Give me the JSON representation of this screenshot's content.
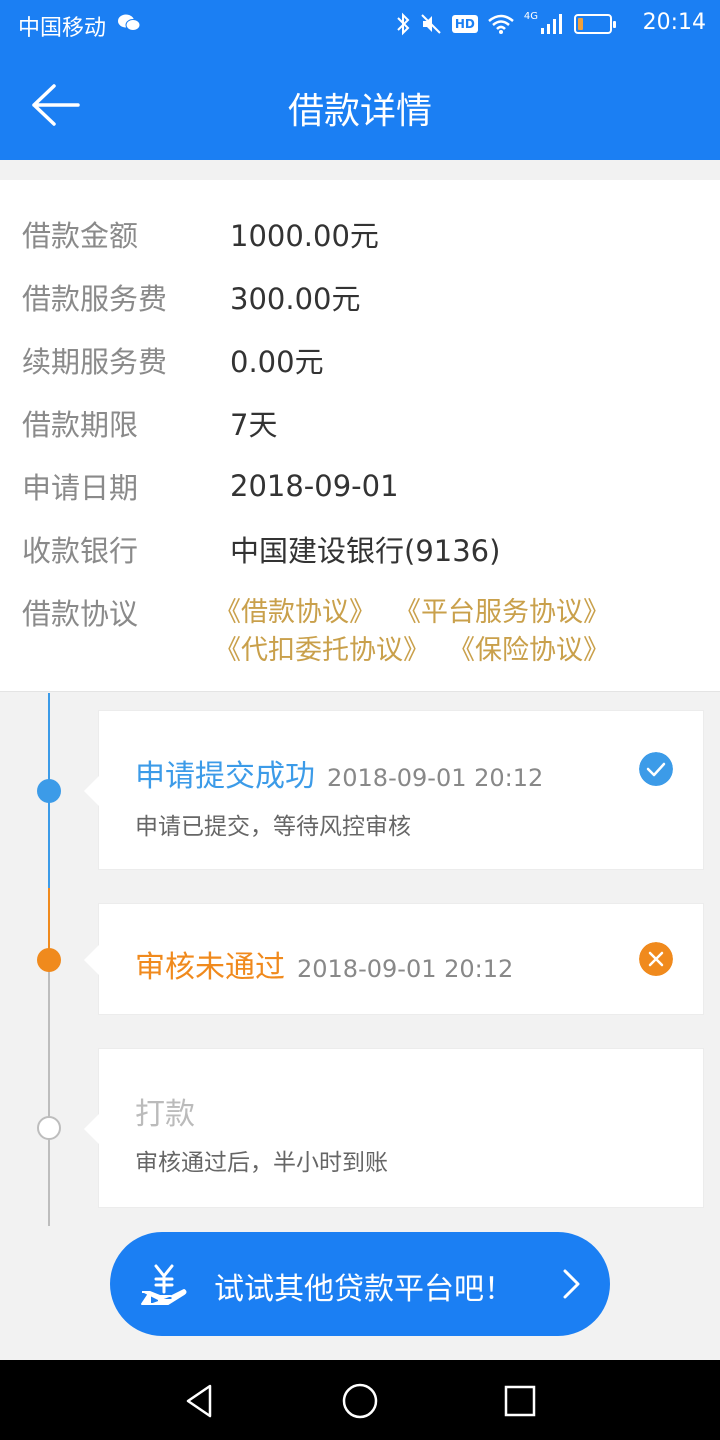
{
  "status_bar": {
    "carrier": "中国移动",
    "hd": "HD",
    "network": "4G",
    "battery_level": 0.15,
    "time": "20:14"
  },
  "nav": {
    "title": "借款详情",
    "back_icon": "back-arrow-icon"
  },
  "details": [
    {
      "label": "借款金额",
      "value": "1000.00元"
    },
    {
      "label": "借款服务费",
      "value": "300.00元"
    },
    {
      "label": "续期服务费",
      "value": "0.00元"
    },
    {
      "label": "借款期限",
      "value": "7天"
    },
    {
      "label": "申请日期",
      "value": "2018-09-01"
    },
    {
      "label": "收款银行",
      "value": "中国建设银行(9136)"
    }
  ],
  "agreements": {
    "label": "借款协议",
    "links": [
      "《借款协议》",
      "《平台服务协议》",
      "《代扣委托协议》",
      "《保险协议》"
    ]
  },
  "timeline": [
    {
      "title": "申请提交成功",
      "time": "2018-09-01 20:12",
      "desc": "申请已提交，等待风控审核",
      "state": "done",
      "color": "#3c9be8",
      "icon": "check-icon"
    },
    {
      "title": "审核未通过",
      "time": "2018-09-01 20:12",
      "desc": "",
      "state": "failed",
      "color": "#f08a1d",
      "icon": "close-icon"
    },
    {
      "title": "打款",
      "time": "",
      "desc": "审核通过后，半小时到账",
      "state": "pending",
      "color": "#bbbbbb",
      "icon": ""
    }
  ],
  "cta": {
    "label": "试试其他贷款平台吧！",
    "icon": "yuan-hand-icon"
  },
  "colors": {
    "primary": "#1b7ff3",
    "gold": "#c9a04b",
    "success_blue": "#3c9be8",
    "fail_orange": "#f08a1d"
  }
}
